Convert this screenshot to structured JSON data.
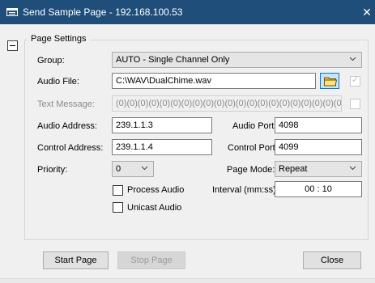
{
  "window": {
    "title": "Send Sample Page - 192.168.100.53",
    "close_glyph": "✕"
  },
  "page_settings": {
    "legend": "Page Settings",
    "group": {
      "label": "Group:",
      "value": "AUTO - Single Channel Only"
    },
    "audio_file": {
      "label": "Audio File:",
      "value": "C:\\WAV\\DualChime.wav",
      "checked": true
    },
    "text_message": {
      "label": "Text Message:",
      "value": "(0)(0)(0)(0)(0)(0)(0)(0)(0)(0)(0)(0)(0)(0)(0)(0)(0)(0)(0)(0)(0)(0)(0)(0)(0)(0)(0)(0)(0)(0)(0)(C",
      "checked": false
    },
    "audio_address": {
      "label": "Audio Address:",
      "value": "239.1.1.3"
    },
    "audio_port": {
      "label": "Audio Port:",
      "value": "4098"
    },
    "control_address": {
      "label": "Control Address:",
      "value": "239.1.1.4"
    },
    "control_port": {
      "label": "Control Port:",
      "value": "4099"
    },
    "priority": {
      "label": "Priority:",
      "value": "0"
    },
    "page_mode": {
      "label": "Page Mode:",
      "value": "Repeat"
    },
    "process_audio": {
      "label": "Process Audio",
      "checked": false
    },
    "unicast_audio": {
      "label": "Unicast Audio",
      "checked": false
    },
    "interval": {
      "label": "Interval (mm:ss)",
      "value": "00  :  10"
    }
  },
  "buttons": {
    "start": "Start Page",
    "stop": "Stop Page",
    "close": "Close"
  },
  "icons": {
    "chevron": "chevron-down-icon",
    "folder": "folder-icon",
    "app": "window-icon"
  },
  "colors": {
    "titlebar": "#1f4e7a",
    "accent": "#0078d7"
  }
}
